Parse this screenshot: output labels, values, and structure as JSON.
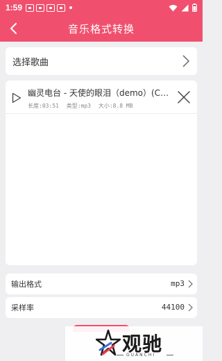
{
  "statusbar": {
    "time": "1:59",
    "icons": [
      "app-icon",
      "app-icon",
      "app-icon",
      "app-icon",
      "dot-icon",
      "wifi-icon",
      "signal-icon",
      "battery-icon"
    ]
  },
  "header": {
    "title": "音乐格式转换",
    "back_icon": "back-arrow-icon"
  },
  "select_song": {
    "label": "选择歌曲"
  },
  "songs": [
    {
      "name": "幽灵电台 - 天使的眼泪（demo）(Cover 李莎)",
      "duration_label": "长度:03:51",
      "type_label": "类型:mp3",
      "size_label": "大小:8.8 MB"
    }
  ],
  "settings": {
    "format": {
      "label": "输出格式",
      "value": "mp3"
    },
    "sample_rate": {
      "label": "采样率",
      "value": "44100"
    }
  },
  "watermark": {
    "text": "观驰",
    "sub": "GUANCHI"
  },
  "colors": {
    "primary": "#f0506e",
    "background": "#efeff1"
  }
}
